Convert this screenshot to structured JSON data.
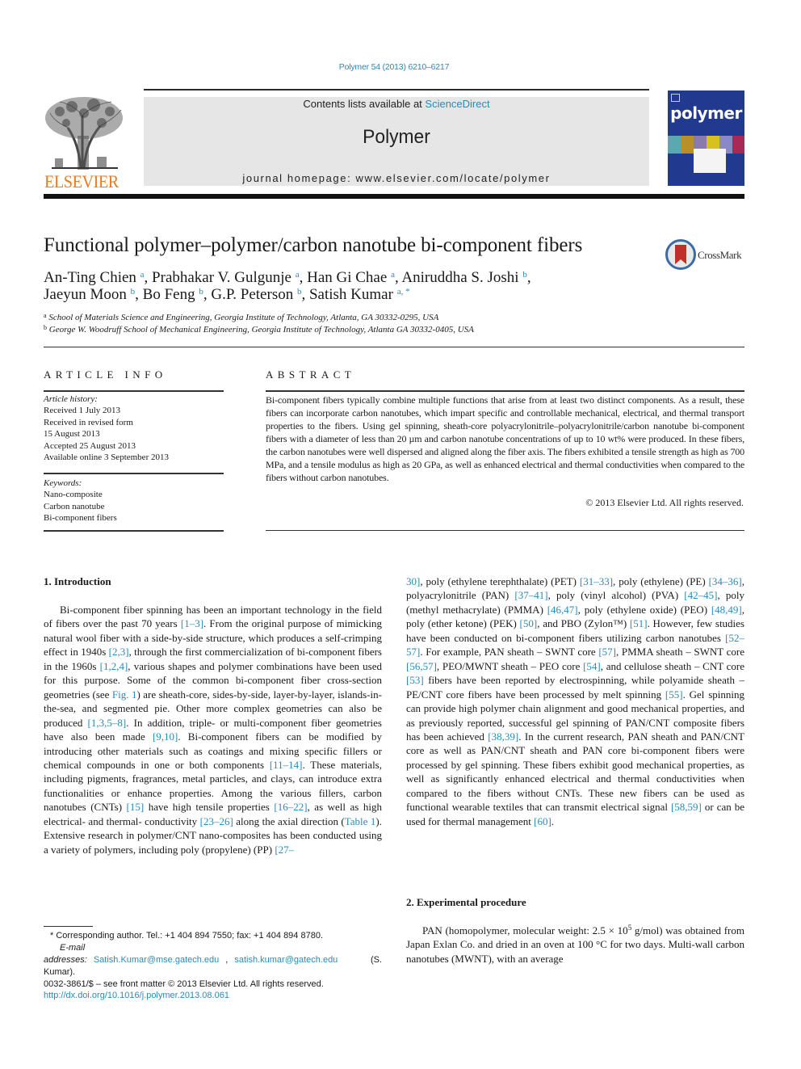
{
  "header": {
    "journal_reference": "Polymer 54 (2013) 6210–6217",
    "contents_prefix": "Contents lists available at ",
    "contents_link": "ScienceDirect",
    "journal_name": "Polymer",
    "homepage": "journal homepage: www.elsevier.com/locate/polymer",
    "publisher_logo": "ELSEVIER",
    "cover_title": "polymer"
  },
  "colors": {
    "link": "#2a8ab8",
    "elsevier_orange": "#f07a1a",
    "cover_blue": "#213a8f",
    "banner_gray": "#e6e6e6",
    "crossmark_red": "#c0302a"
  },
  "article": {
    "title": "Functional polymer–polymer/carbon nanotube bi-component fibers",
    "crossmark_label": "CrossMark",
    "authors": [
      {
        "name": "An-Ting Chien",
        "aff": "a"
      },
      {
        "name": "Prabhakar V. Gulgunje",
        "aff": "a"
      },
      {
        "name": "Han Gi Chae",
        "aff": "a"
      },
      {
        "name": "Aniruddha S. Joshi",
        "aff": "b"
      },
      {
        "name": "Jaeyun Moon",
        "aff": "b"
      },
      {
        "name": "Bo Feng",
        "aff": "b"
      },
      {
        "name": "G.P. Peterson",
        "aff": "b"
      },
      {
        "name": "Satish Kumar",
        "aff": "a, *"
      }
    ],
    "affiliations": [
      {
        "mark": "a",
        "text": "School of Materials Science and Engineering, Georgia Institute of Technology, Atlanta, GA 30332-0295, USA"
      },
      {
        "mark": "b",
        "text": "George W. Woodruff School of Mechanical Engineering, Georgia Institute of Technology, Atlanta GA 30332-0405, USA"
      }
    ]
  },
  "article_info": {
    "heading": "ARTICLE INFO",
    "history_label": "Article history:",
    "history": [
      "Received 1 July 2013",
      "Received in revised form",
      "15 August 2013",
      "Accepted 25 August 2013",
      "Available online 3 September 2013"
    ],
    "keywords_label": "Keywords:",
    "keywords": [
      "Nano-composite",
      "Carbon nanotube",
      "Bi-component fibers"
    ]
  },
  "abstract": {
    "heading": "ABSTRACT",
    "text": "Bi-component fibers typically combine multiple functions that arise from at least two distinct components. As a result, these fibers can incorporate carbon nanotubes, which impart specific and controllable mechanical, electrical, and thermal transport properties to the fibers. Using gel spinning, sheath-core polyacrylonitrile–polyacrylonitrile/carbon nanotube bi-component fibers with a diameter of less than 20 µm and carbon nanotube concentrations of up to 10 wt% were produced. In these fibers, the carbon nanotubes were well dispersed and aligned along the fiber axis. The fibers exhibited a tensile strength as high as 700 MPa, and a tensile modulus as high as 20 GPa, as well as enhanced electrical and thermal conductivities when compared to the fibers without carbon nanotubes.",
    "copyright": "© 2013 Elsevier Ltd. All rights reserved."
  },
  "sections": {
    "intro_heading": "1.  Introduction",
    "intro_left": [
      {
        "t": "Bi-component fiber spinning has been an important technology in the field of fibers over the past 70 years "
      },
      {
        "ref": "[1–3]"
      },
      {
        "t": ". From the original purpose of mimicking natural wool fiber with a side-by-side structure, which produces a self-crimping effect in 1940s "
      },
      {
        "ref": "[2,3]"
      },
      {
        "t": ", through the first commercialization of bi-component fibers in the 1960s "
      },
      {
        "ref": "[1,2,4]"
      },
      {
        "t": ", various shapes and polymer combinations have been used for this purpose. Some of the common bi-component fiber cross-section geometries (see "
      },
      {
        "ref": "Fig. 1"
      },
      {
        "t": ") are sheath-core, sides-by-side, layer-by-layer, islands-in-the-sea, and segmented pie. Other more complex geometries can also be produced "
      },
      {
        "ref": "[1,3,5–8]"
      },
      {
        "t": ". In addition, triple- or multi-component fiber geometries have also been made "
      },
      {
        "ref": "[9,10]"
      },
      {
        "t": ". Bi-component fibers can be modified by introducing other materials such as coatings and mixing specific fillers or chemical compounds in one or both components "
      },
      {
        "ref": "[11–14]"
      },
      {
        "t": ". These materials, including pigments, fragrances, metal particles, and clays, can introduce extra functionalities or enhance properties. Among the various fillers, carbon nanotubes (CNTs) "
      },
      {
        "ref": "[15]"
      },
      {
        "t": " have high tensile properties "
      },
      {
        "ref": "[16–22]"
      },
      {
        "t": ", as well as high electrical- and thermal- conductivity "
      },
      {
        "ref": "[23–26]"
      },
      {
        "t": " along the axial direction ("
      },
      {
        "ref": "Table 1"
      },
      {
        "t": "). Extensive research in polymer/CNT nano-composites has been conducted using a variety of polymers, including poly (propylene) (PP) "
      },
      {
        "ref": "[27–"
      }
    ],
    "intro_right": [
      {
        "ref": "30]"
      },
      {
        "t": ", poly (ethylene terephthalate) (PET) "
      },
      {
        "ref": "[31–33]"
      },
      {
        "t": ", poly (ethylene) (PE) "
      },
      {
        "ref": "[34–36]"
      },
      {
        "t": ", polyacrylonitrile (PAN) "
      },
      {
        "ref": "[37–41]"
      },
      {
        "t": ", poly (vinyl alcohol) (PVA) "
      },
      {
        "ref": "[42–45]"
      },
      {
        "t": ", poly (methyl methacrylate) (PMMA) "
      },
      {
        "ref": "[46,47]"
      },
      {
        "t": ", poly (ethylene oxide) (PEO) "
      },
      {
        "ref": "[48,49]"
      },
      {
        "t": ", poly (ether ketone) (PEK) "
      },
      {
        "ref": "[50]"
      },
      {
        "t": ", and PBO (Zylon™) "
      },
      {
        "ref": "[51]"
      },
      {
        "t": ". However, few studies have been conducted on bi-component fibers utilizing carbon nanotubes "
      },
      {
        "ref": "[52–57]"
      },
      {
        "t": ". For example, PAN sheath – SWNT core "
      },
      {
        "ref": "[57]"
      },
      {
        "t": ", PMMA sheath – SWNT core "
      },
      {
        "ref": "[56,57]"
      },
      {
        "t": ", PEO/MWNT sheath – PEO core "
      },
      {
        "ref": "[54]"
      },
      {
        "t": ", and cellulose sheath – CNT core "
      },
      {
        "ref": "[53]"
      },
      {
        "t": " fibers have been reported by electrospinning, while polyamide sheath – PE/CNT core fibers have been processed by melt spinning "
      },
      {
        "ref": "[55]"
      },
      {
        "t": ". Gel spinning can provide high polymer chain alignment and good mechanical properties, and as previously reported, successful gel spinning of PAN/CNT composite fibers has been achieved "
      },
      {
        "ref": "[38,39]"
      },
      {
        "t": ". In the current research, PAN sheath and PAN/CNT core as well as PAN/CNT sheath and PAN core bi-component fibers were processed by gel spinning. These fibers exhibit good mechanical properties, as well as significantly enhanced electrical and thermal conductivities when compared to the fibers without CNTs. These new fibers can be used as functional wearable textiles that can transmit electrical signal "
      },
      {
        "ref": "[58,59]"
      },
      {
        "t": " or can be used for thermal management "
      },
      {
        "ref": "[60]"
      },
      {
        "t": "."
      }
    ],
    "exp_heading": "2.  Experimental procedure",
    "exp_text_1": "PAN (homopolymer, molecular weight: 2.5 × 10",
    "exp_sup": "5",
    "exp_text_2": " g/mol) was obtained from Japan Exlan Co. and dried in an oven at 100 °C for two days. Multi-wall carbon nanotubes (MWNT), with an average"
  },
  "footnotes": {
    "corresponding": "* Corresponding author. Tel.: +1 404 894 7550; fax: +1 404 894 8780.",
    "email_label": "E-mail addresses:",
    "emails": [
      "Satish.Kumar@mse.gatech.edu",
      "satish.kumar@gatech.edu"
    ],
    "email_suffix": "(S. Kumar).",
    "front_matter": "0032-3861/$ – see front matter © 2013 Elsevier Ltd. All rights reserved.",
    "doi": "http://dx.doi.org/10.1016/j.polymer.2013.08.061"
  }
}
